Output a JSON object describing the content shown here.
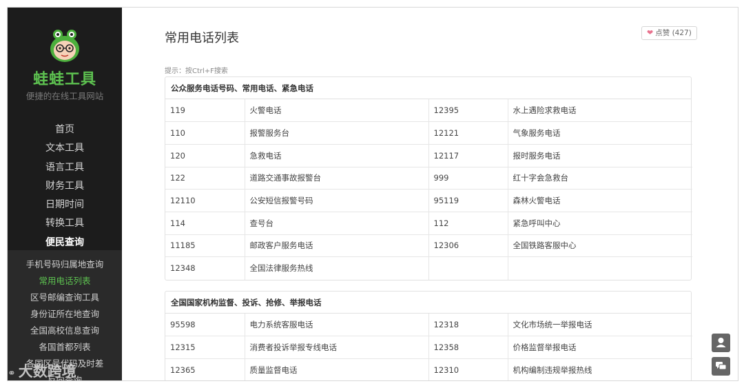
{
  "sidebar": {
    "brand": "蛙蛙工具",
    "tagline": "便捷的在线工具网站",
    "menu": [
      "首页",
      "文本工具",
      "语言工具",
      "财务工具",
      "日期时间",
      "转换工具",
      "便民查询"
    ],
    "submenu": [
      "手机号码归属地查询",
      "常用电话列表",
      "区号邮编查询工具",
      "身份证所在地查询",
      "全国高校信息查询",
      "各国首都列表",
      "各国区号代码及时差",
      "反向查询"
    ]
  },
  "main": {
    "title": "常用电话列表",
    "like": {
      "label": "点赞",
      "count": "(427)"
    },
    "hint": "提示：按Ctrl+F搜索"
  },
  "sections": [
    {
      "heading": "公众服务电话号码、常用电话、紧急电话",
      "rows": [
        [
          "119",
          "火警电话",
          "12395",
          "水上遇险求救电话"
        ],
        [
          "110",
          "报警服务台",
          "12121",
          "气象服务电话"
        ],
        [
          "120",
          "急救电话",
          "12117",
          "报时服务电话"
        ],
        [
          "122",
          "道路交通事故报警台",
          "999",
          "红十字会急救台"
        ],
        [
          "12110",
          "公安短信报警号码",
          "95119",
          "森林火警电话"
        ],
        [
          "114",
          "查号台",
          "112",
          "紧急呼叫中心"
        ],
        [
          "11185",
          "邮政客户服务电话",
          "12306",
          "全国铁路客服中心"
        ],
        [
          "12348",
          "全国法律服务热线",
          "",
          ""
        ]
      ]
    },
    {
      "heading": "全国国家机构监督、投诉、抢修、举报电话",
      "rows": [
        [
          "95598",
          "电力系统客服电话",
          "12318",
          "文化市场统一举报电话"
        ],
        [
          "12315",
          "消费者投诉举报专线电话",
          "12358",
          "价格监督举报电话"
        ],
        [
          "12365",
          "质量监督电话",
          "12310",
          "机构编制违规举报热线"
        ]
      ]
    }
  ],
  "watermark": "大数跨境",
  "icons": {
    "logo": "frog-logo-icon",
    "heart": "heart-icon",
    "user": "user-icon",
    "chat": "chat-icon"
  },
  "colors": {
    "brand_green": "#5dc150",
    "sidebar_bg": "#1c1c1c",
    "submenu_bg": "#2a2a2a",
    "heart": "#e8718d"
  }
}
